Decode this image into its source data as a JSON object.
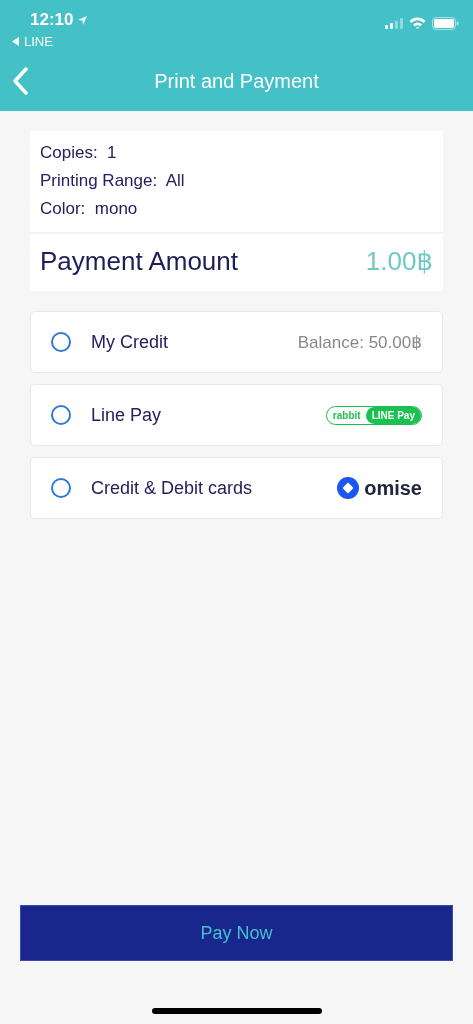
{
  "status_bar": {
    "time": "12:10",
    "back_app": "LINE"
  },
  "header": {
    "title": "Print and Payment"
  },
  "summary": {
    "details": [
      {
        "label": "Copies:",
        "value": "1"
      },
      {
        "label": "Printing Range:",
        "value": "All"
      },
      {
        "label": "Color:",
        "value": "mono"
      }
    ],
    "amount_label": "Payment Amount",
    "amount": "1.00฿"
  },
  "options": [
    {
      "label": "My Credit",
      "selected": false,
      "kind": "balance",
      "balance": "Balance: 50.00฿"
    },
    {
      "label": "Line Pay",
      "selected": false,
      "kind": "linepay",
      "logo_left": "rabbit",
      "logo_right": "LINE Pay"
    },
    {
      "label": "Credit & Debit cards",
      "selected": false,
      "kind": "omise",
      "logo": "omise"
    }
  ],
  "pay_button": "Pay Now"
}
